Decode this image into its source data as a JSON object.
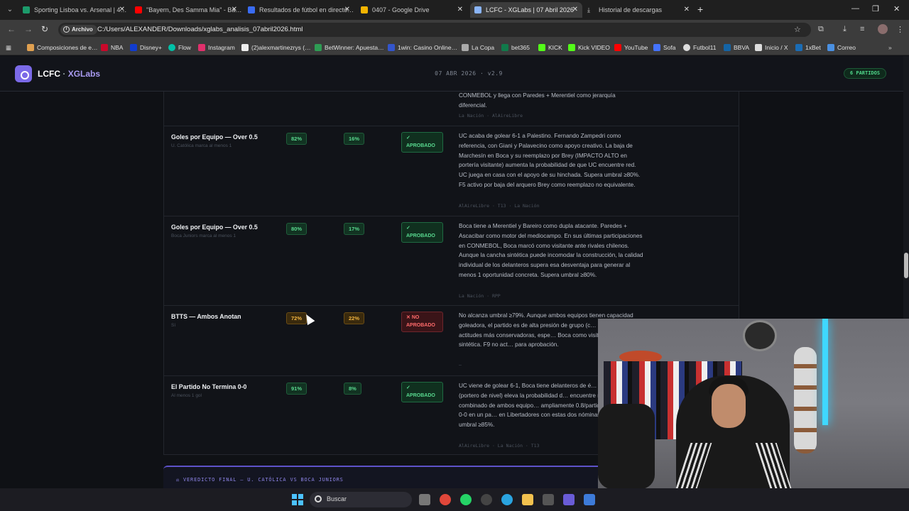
{
  "browser": {
    "tabs": [
      {
        "title": "Sporting Lisboa vs. Arsenal | 4…",
        "active": false,
        "favicon_color": "#1c9b6b"
      },
      {
        "title": "\"Bayern, Des Samma Mia\" - Ba…",
        "active": false,
        "favicon_color": "#ff0000"
      },
      {
        "title": "Resultados de fútbol en directo…",
        "active": false,
        "favicon_color": "#3a6cf4"
      },
      {
        "title": "0407 - Google Drive",
        "active": false,
        "favicon_color": "#f4b400"
      },
      {
        "title": "LCFC - XGLabs | 07 Abril 2026",
        "active": true,
        "favicon_color": "#8ab4f8"
      },
      {
        "title": "Historial de descargas",
        "active": false,
        "favicon_color": "#cccccc"
      }
    ],
    "address_chip": "Archivo",
    "url": "C:/Users/ALEXANDER/Downloads/xglabs_analisis_07abril2026.html",
    "bookmarks": [
      {
        "label": "Composiciones de e…",
        "color": "#e0a050"
      },
      {
        "label": "NBA",
        "color": "#c9082a"
      },
      {
        "label": "Disney+",
        "color": "#113ccf"
      },
      {
        "label": "Flow",
        "color": "#00c2a8"
      },
      {
        "label": "Instagram",
        "color": "#e1306c"
      },
      {
        "label": "(2)alexmartinezrys (…",
        "color": "#eeeeee"
      },
      {
        "label": "BetWinner: Apuesta…",
        "color": "#2e9c54"
      },
      {
        "label": "1win: Casino Online…",
        "color": "#3355cc"
      },
      {
        "label": "La Copa",
        "color": "#aaaaaa"
      },
      {
        "label": "bet365",
        "color": "#117a4b"
      },
      {
        "label": "KICK",
        "color": "#53fc18"
      },
      {
        "label": "Kick VIDEO",
        "color": "#53fc18"
      },
      {
        "label": "YouTube",
        "color": "#ff0000"
      },
      {
        "label": "Sofa",
        "color": "#4473ff"
      },
      {
        "label": "Futbol11",
        "color": "#dddddd"
      },
      {
        "label": "BBVA",
        "color": "#1464a5"
      },
      {
        "label": "Inicio / X",
        "color": "#dddddd"
      },
      {
        "label": "1xBet",
        "color": "#1a6cb5"
      },
      {
        "label": "Correo",
        "color": "#4a90e2"
      }
    ]
  },
  "app": {
    "brand_main": "LCFC",
    "brand_sep": "·",
    "brand_accent": "XGLabs",
    "date_version": "07 ABR 2026 · v2.9",
    "matches_badge": "6 PARTIDOS",
    "accent_color": "#7b6ae8"
  },
  "previous_row": {
    "analysis_tail": "CONMEBOL y llega con Paredes + Merentiel como jerarquía diferencial.",
    "sources": "La Nación · AlAireLibre"
  },
  "markets": [
    {
      "title": "Goles por Equipo — Over 0.5",
      "subtitle": "U. Católica marca al menos 1",
      "prob": "82%",
      "prob_color": "green",
      "counter": "16%",
      "counter_color": "green",
      "verdict_icon": "✓",
      "verdict": "APROBADO",
      "approved": true,
      "analysis": "UC acaba de golear 6-1 a Palestino. Fernando Zampedri como referencia, con Giani y Palavecino como apoyo creativo. La baja de Marchesín en Boca y su reemplazo por Brey (IMPACTO ALTO en portería visitante) aumenta la probabilidad de que UC encuentre red. UC juega en casa con el apoyo de su hinchada. Supera umbral ≥80%. F5 activo por baja del arquero Brey como reemplazo no equivalente.",
      "sources": "AlAireLibre · T13 · La Nación"
    },
    {
      "title": "Goles por Equipo — Over 0.5",
      "subtitle": "Boca Juniors marca al menos 1",
      "prob": "80%",
      "prob_color": "green",
      "counter": "17%",
      "counter_color": "green",
      "verdict_icon": "✓",
      "verdict": "APROBADO",
      "approved": true,
      "analysis": "Boca tiene a Merentiel y Bareiro como dupla atacante. Paredes + Ascacibar como motor del mediocampo. En sus últimas participaciones en CONMEBOL, Boca marcó como visitante ante rivales chilenos. Aunque la cancha sintética puede incomodar la construcción, la calidad individual de los delanteros supera esa desventaja para generar al menos 1 oportunidad concreta. Supera umbral ≥80%.",
      "sources": "La Nación · RPP"
    },
    {
      "title": "BTTS — Ambos Anotan",
      "subtitle": "Sí",
      "prob": "72%",
      "prob_color": "amber",
      "counter": "22%",
      "counter_color": "amber",
      "verdict_icon": "✕",
      "verdict": "NO APROBADO",
      "approved": false,
      "analysis": "No alcanza umbral ≥79%. Aunque ambos equipos tienen capacidad goleadora, el partido es de alta presión de grupo (c… puede generar actitudes más conservadoras, espe… Boca como visitante en cancha sintética. F9 no act… para aprobación.",
      "sources": "—"
    },
    {
      "title": "El Partido No Termina 0-0",
      "subtitle": "Al menos 1 gol",
      "prob": "91%",
      "prob_color": "green",
      "counter": "8%",
      "counter_color": "green",
      "verdict_icon": "✓",
      "verdict": "APROBADO",
      "approved": true,
      "analysis": "UC viene de golear 6-1, Boca tiene delanteros de é… Marchesín (portero de nivel) eleva la probabilidad d… encuentre red. El xG combinado de ambos equipo… ampliamente 0.8/partido individual. El 0-0 en un pa… en Libertadores con estas dos nóminas sería impro… umbral ≥85%.",
      "sources": "AlAireLibre · La Nación · T13"
    }
  ],
  "final_verdict": {
    "label": "⚖ VEREDICTO FINAL — U. CATÓLICA VS BOCA JUNIORS"
  },
  "taskbar": {
    "search_placeholder": "Buscar"
  }
}
